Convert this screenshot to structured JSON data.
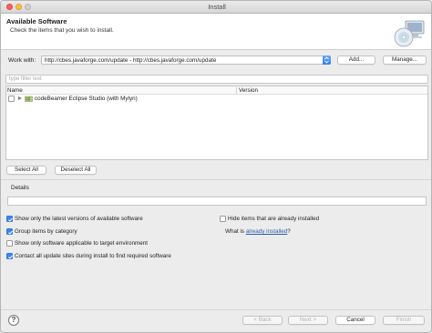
{
  "window": {
    "title": "Install"
  },
  "header": {
    "title": "Available Software",
    "subtitle": "Check the items that you wish to install.",
    "icon": "install-cd-computer-icon"
  },
  "work_with": {
    "label": "Work with:",
    "value": "http://cbes.javaforge.com/update - http://cbes.javaforge.com/update",
    "add_label": "Add...",
    "manage_label": "Manage..."
  },
  "filter": {
    "placeholder": "type filter text"
  },
  "tree": {
    "columns": [
      "Name",
      "Version"
    ],
    "rows": [
      {
        "label": "codeBeamer Eclipse Studio (with Mylyn)",
        "checked": false,
        "expanded": false,
        "version": ""
      }
    ]
  },
  "selection": {
    "select_all_label": "Select All",
    "deselect_all_label": "Deselect All"
  },
  "details": {
    "label": "Details"
  },
  "options": {
    "show_latest": {
      "label": "Show only the latest versions of available software",
      "checked": true
    },
    "group_by_category": {
      "label": "Group items by category",
      "checked": true
    },
    "show_applicable": {
      "label": "Show only software applicable to target environment",
      "checked": false
    },
    "contact_sites": {
      "label": "Contact all update sites during install to find required software",
      "checked": true
    },
    "hide_installed": {
      "label": "Hide items that are already installed",
      "checked": false
    },
    "what_is_prefix": "What is ",
    "what_is_link": "already installed",
    "what_is_suffix": "?"
  },
  "footer": {
    "help_glyph": "?",
    "back_label": "< Back",
    "next_label": "Next >",
    "cancel_label": "Cancel",
    "finish_label": "Finish"
  },
  "colors": {
    "accent": "#3b86f7",
    "link": "#2a5db0"
  }
}
